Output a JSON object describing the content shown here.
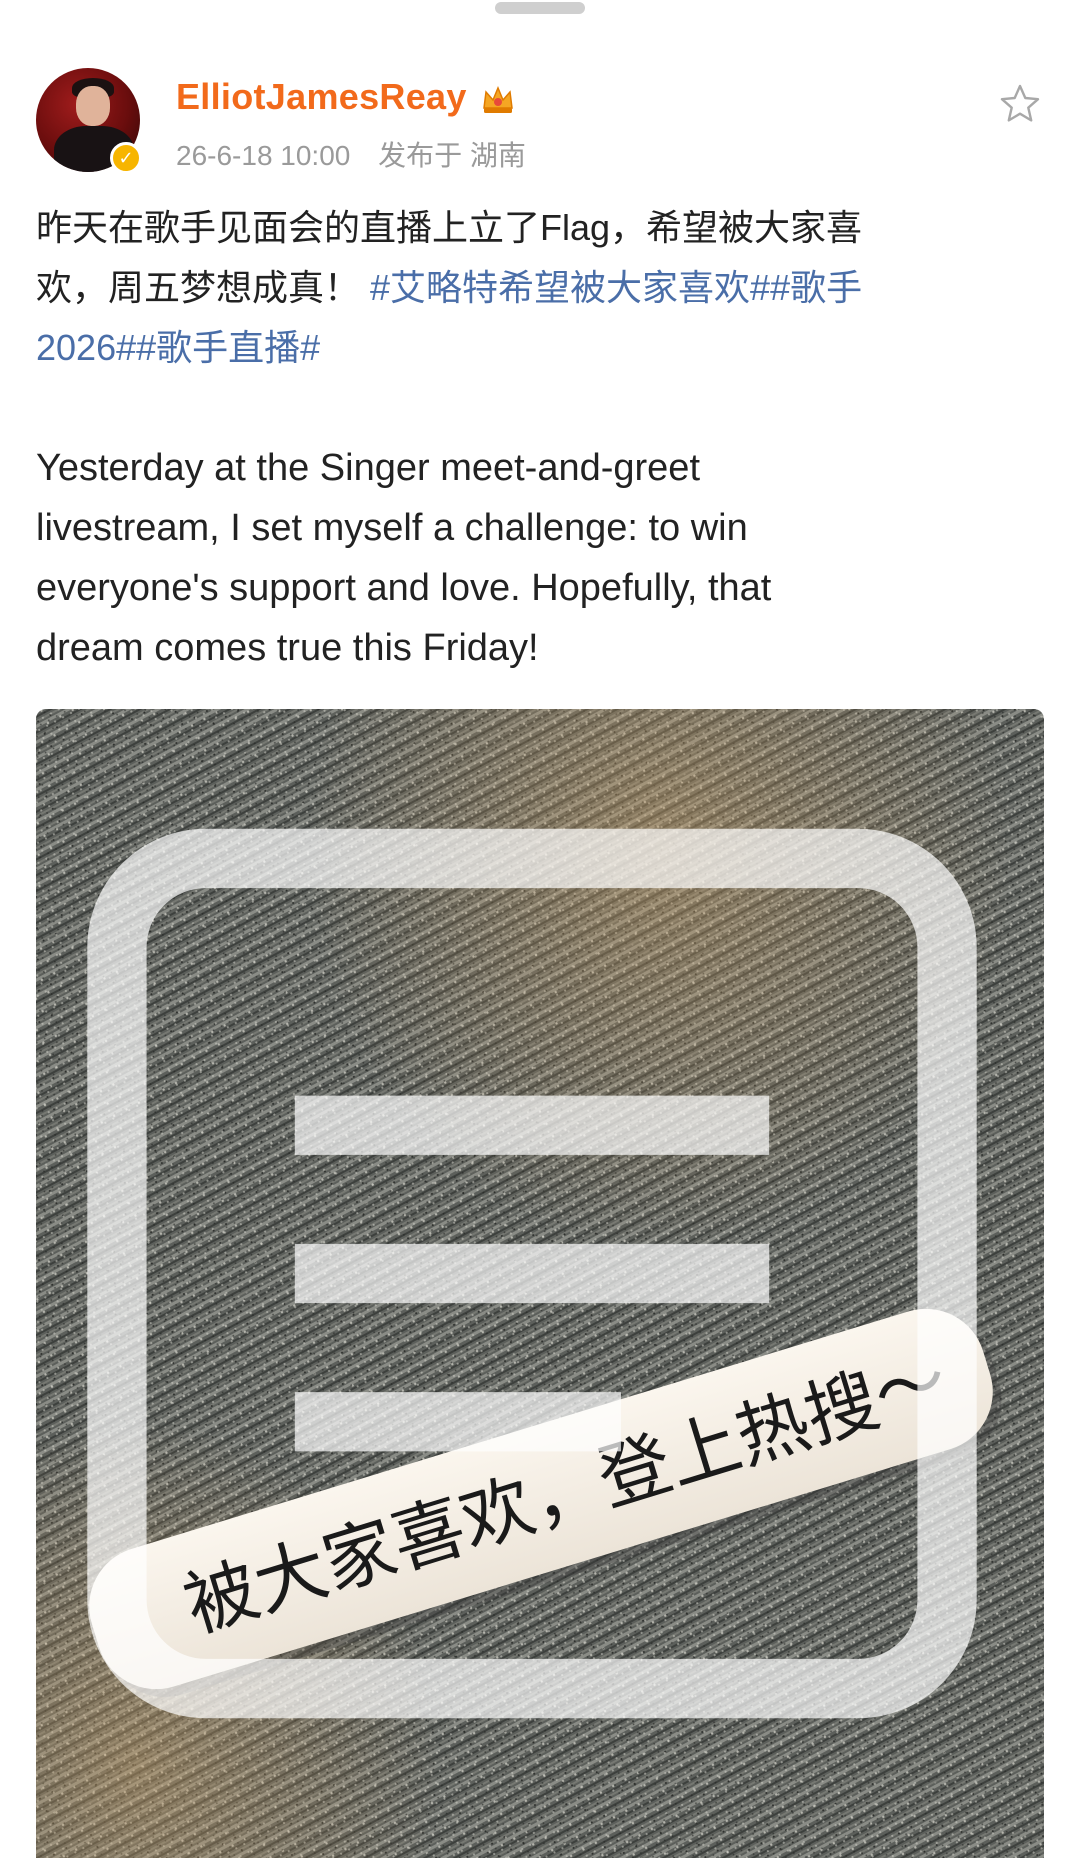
{
  "post": {
    "username": "ElliotJamesReay",
    "timestamp": "26-6-18 10:00",
    "location": "发布于 湖南",
    "text_zh_lines": [
      "昨天在歌手见面会的直播上立了Flag，希望被大家喜",
      "欢，周五梦想成真！"
    ],
    "hashtags_line1": "#艾略特希望被大家喜欢##歌手",
    "hashtags_line2": "2026##歌手直播#",
    "text_en_lines": [
      "Yesterday at the Singer meet-and-greet",
      "livestream, I set myself a challenge: to win",
      "everyone's support and love. Hopefully, that",
      "dream comes true this Friday!"
    ],
    "image": {
      "note_text": "被大家喜欢，登上热搜～"
    }
  },
  "icons": {
    "favorite": "star-icon",
    "badge": "crown-icon",
    "verified": "verified-badge-icon"
  },
  "colors": {
    "username": "#f26a1b",
    "hashtag": "#4a6ea8",
    "meta": "#9a9a9a",
    "verified": "#f7b500"
  }
}
